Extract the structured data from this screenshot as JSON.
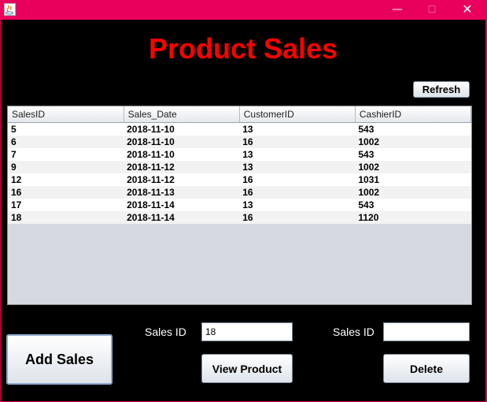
{
  "window": {
    "minimize_glyph": "—",
    "maximize_glyph": "☐",
    "close_glyph": "✕",
    "icon": "java-app-icon"
  },
  "page": {
    "title": "Product Sales"
  },
  "toolbar": {
    "refresh_label": "Refresh"
  },
  "table": {
    "columns": [
      "SalesID",
      "Sales_Date",
      "CustomerID",
      "CashierID"
    ],
    "rows": [
      [
        "5",
        "2018-11-10",
        "13",
        "543"
      ],
      [
        "6",
        "2018-11-10",
        "16",
        "1002"
      ],
      [
        "7",
        "2018-11-10",
        "13",
        "543"
      ],
      [
        "9",
        "2018-11-12",
        "13",
        "1002"
      ],
      [
        "12",
        "2018-11-12",
        "16",
        "1031"
      ],
      [
        "16",
        "2018-11-13",
        "16",
        "1002"
      ],
      [
        "17",
        "2018-11-14",
        "13",
        "543"
      ],
      [
        "18",
        "2018-11-14",
        "16",
        "1120"
      ]
    ]
  },
  "form": {
    "sales_id_label_1": "Sales ID",
    "sales_id_value_1": "18",
    "sales_id_label_2": "Sales ID",
    "sales_id_value_2": ""
  },
  "buttons": {
    "add_sales": "Add Sales",
    "view_product": "View Product",
    "delete": "Delete"
  },
  "colors": {
    "titlebar": "#e8005c",
    "title_text": "#ff0000",
    "background": "#000000"
  }
}
